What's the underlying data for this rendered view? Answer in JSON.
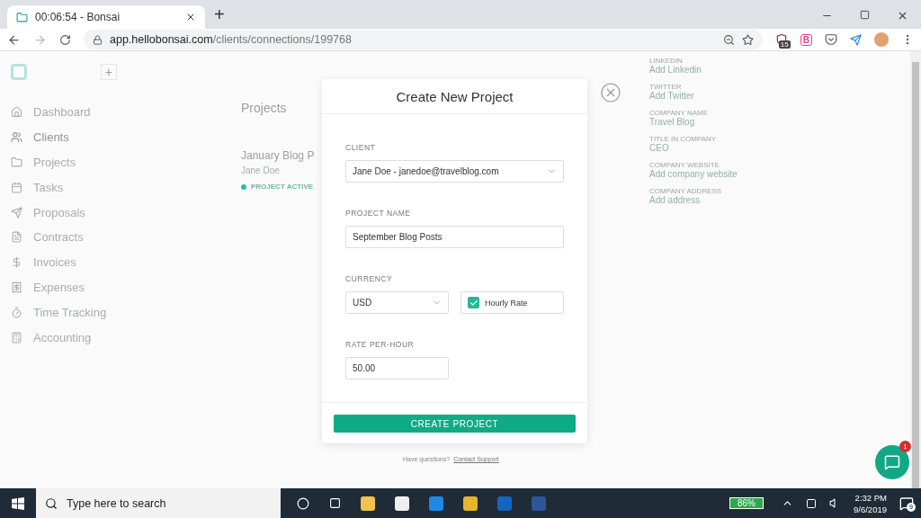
{
  "browser": {
    "tab_title": "00:06:54 - Bonsai",
    "new_tab": "+",
    "url_host": "app.hellobonsai.com",
    "url_path": "/clients/connections/199768",
    "extension_badge": "15",
    "extension_letter": "B"
  },
  "sidebar": {
    "add": "+",
    "items": [
      {
        "label": "Dashboard",
        "selected": false
      },
      {
        "label": "Clients",
        "selected": true
      },
      {
        "label": "Projects",
        "selected": false
      },
      {
        "label": "Tasks",
        "selected": false
      },
      {
        "label": "Proposals",
        "selected": false
      },
      {
        "label": "Contracts",
        "selected": false
      },
      {
        "label": "Invoices",
        "selected": false
      },
      {
        "label": "Expenses",
        "selected": false
      },
      {
        "label": "Time Tracking",
        "selected": false
      },
      {
        "label": "Accounting",
        "selected": false
      }
    ]
  },
  "projects": {
    "title": "Projects",
    "card": {
      "name": "January Blog P",
      "client": "Jane Doe",
      "status": "PROJECT ACTIVE",
      "color": "#26c2a2"
    }
  },
  "details": [
    {
      "label": "LINKEDIN",
      "value": "Add Linkedin"
    },
    {
      "label": "TWITTER",
      "value": "Add Twitter"
    },
    {
      "label": "COMPANY NAME",
      "value": "Travel Blog"
    },
    {
      "label": "TITLE IN COMPANY",
      "value": "CEO"
    },
    {
      "label": "COMPANY WEBSITE",
      "value": "Add company website"
    },
    {
      "label": "COMPANY ADDRESS",
      "value": "Add address"
    }
  ],
  "modal": {
    "title": "Create New Project",
    "client": {
      "label": "CLIENT",
      "value": "Jane Doe - janedoe@travelblog.com"
    },
    "project_name": {
      "label": "PROJECT NAME",
      "value": "September Blog Posts"
    },
    "currency": {
      "label": "CURRENCY",
      "value": "USD"
    },
    "hourly_rate": {
      "label": "Hourly Rate",
      "checked": true
    },
    "rate": {
      "label": "RATE PER-HOUR",
      "value": "50.00"
    },
    "submit": "CREATE PROJECT"
  },
  "help": {
    "text": "Have questions?",
    "link": "Contact Support"
  },
  "chat": {
    "badge": "1"
  },
  "taskbar": {
    "search_placeholder": "Type here to search",
    "battery": "86%",
    "time": "2:32 PM",
    "date": "9/6/2019",
    "notifications": "9"
  }
}
